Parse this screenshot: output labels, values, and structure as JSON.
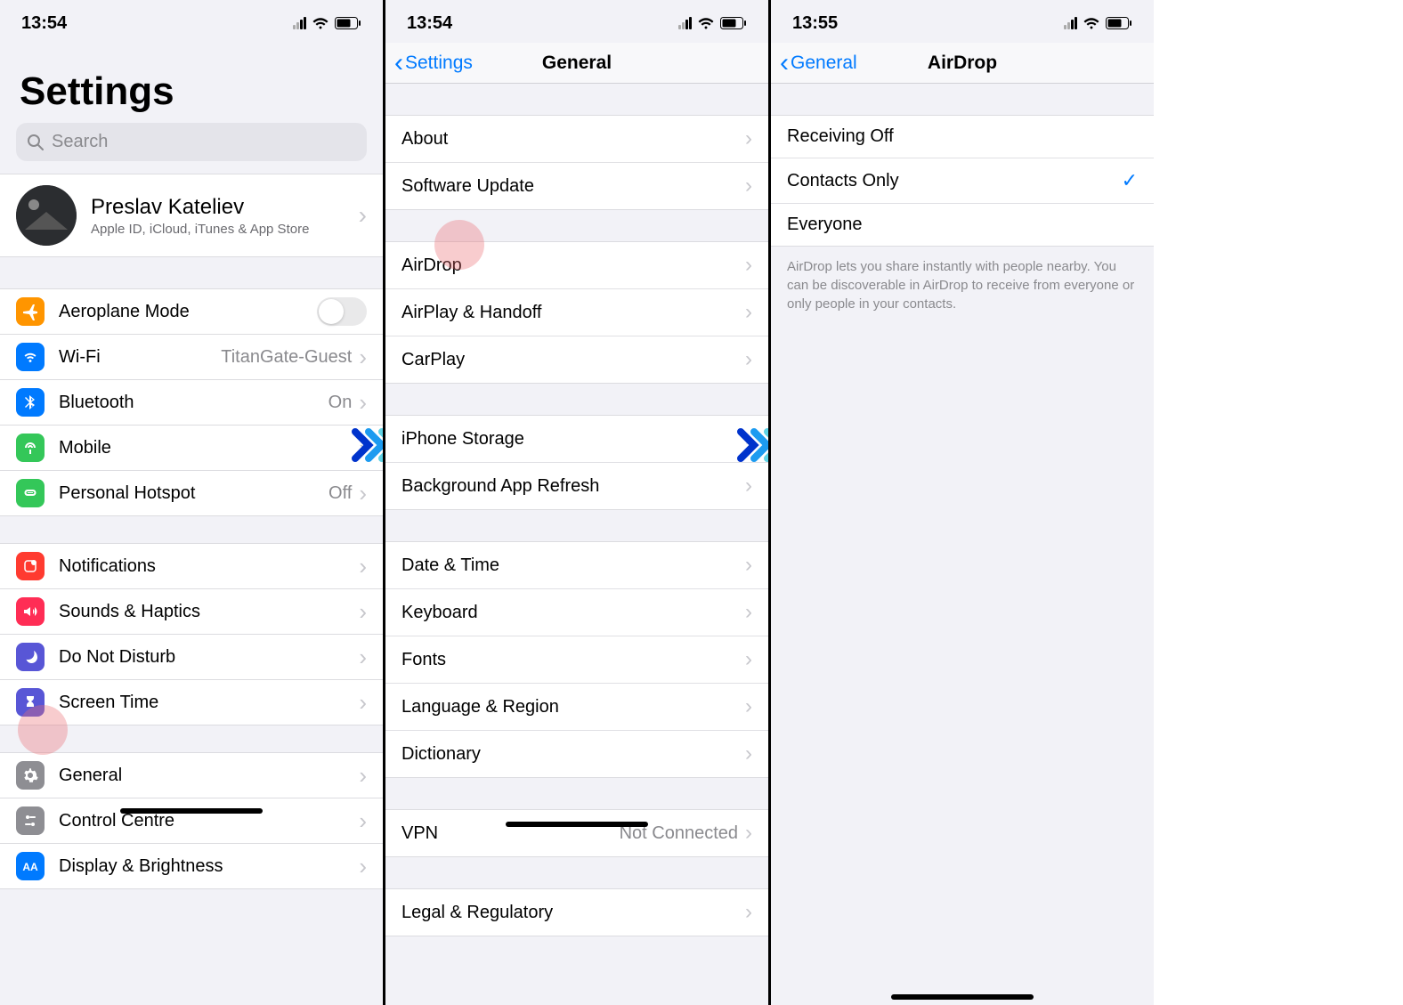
{
  "screen1": {
    "status": {
      "time": "13:54"
    },
    "title": "Settings",
    "search_placeholder": "Search",
    "profile": {
      "name": "Preslav Kateliev",
      "subtitle": "Apple ID, iCloud, iTunes & App Store"
    },
    "groups": [
      {
        "rows": [
          {
            "icon": "airplane",
            "color": "bg-orange",
            "label": "Aeroplane Mode",
            "type": "toggle"
          },
          {
            "icon": "wifi",
            "color": "bg-blue",
            "label": "Wi-Fi",
            "value": "TitanGate-Guest",
            "type": "nav"
          },
          {
            "icon": "bluetooth",
            "color": "bg-blue",
            "label": "Bluetooth",
            "value": "On",
            "type": "nav"
          },
          {
            "icon": "antenna",
            "color": "bg-green",
            "label": "Mobile",
            "type": "nav"
          },
          {
            "icon": "link",
            "color": "bg-green",
            "label": "Personal Hotspot",
            "value": "Off",
            "type": "nav"
          }
        ]
      },
      {
        "rows": [
          {
            "icon": "bell",
            "color": "bg-red",
            "label": "Notifications",
            "type": "nav"
          },
          {
            "icon": "speaker",
            "color": "bg-pink",
            "label": "Sounds & Haptics",
            "type": "nav"
          },
          {
            "icon": "moon",
            "color": "bg-purple",
            "label": "Do Not Disturb",
            "type": "nav"
          },
          {
            "icon": "hourglass",
            "color": "bg-purple",
            "label": "Screen Time",
            "type": "nav"
          }
        ]
      },
      {
        "rows": [
          {
            "icon": "gear",
            "color": "bg-gray",
            "label": "General",
            "type": "nav",
            "highlight": true
          },
          {
            "icon": "switches",
            "color": "bg-gray",
            "label": "Control Centre",
            "type": "nav"
          },
          {
            "icon": "aa",
            "color": "bg-blue",
            "label": "Display & Brightness",
            "type": "nav"
          }
        ]
      }
    ]
  },
  "screen2": {
    "status": {
      "time": "13:54"
    },
    "back": "Settings",
    "title": "General",
    "groups": [
      {
        "rows": [
          {
            "label": "About"
          },
          {
            "label": "Software Update"
          }
        ]
      },
      {
        "rows": [
          {
            "label": "AirDrop",
            "highlight": true
          },
          {
            "label": "AirPlay & Handoff"
          },
          {
            "label": "CarPlay"
          }
        ]
      },
      {
        "rows": [
          {
            "label": "iPhone Storage"
          },
          {
            "label": "Background App Refresh"
          }
        ]
      },
      {
        "rows": [
          {
            "label": "Date & Time"
          },
          {
            "label": "Keyboard"
          },
          {
            "label": "Fonts"
          },
          {
            "label": "Language & Region"
          },
          {
            "label": "Dictionary"
          }
        ]
      },
      {
        "rows": [
          {
            "label": "VPN",
            "value": "Not Connected"
          }
        ]
      },
      {
        "rows": [
          {
            "label": "Legal & Regulatory"
          }
        ]
      }
    ]
  },
  "screen3": {
    "status": {
      "time": "13:55"
    },
    "back": "General",
    "title": "AirDrop",
    "options": [
      {
        "label": "Receiving Off",
        "selected": false
      },
      {
        "label": "Contacts Only",
        "selected": true
      },
      {
        "label": "Everyone",
        "selected": false
      }
    ],
    "footer": "AirDrop lets you share instantly with people nearby. You can be discoverable in AirDrop to receive from everyone or only people in your contacts."
  }
}
